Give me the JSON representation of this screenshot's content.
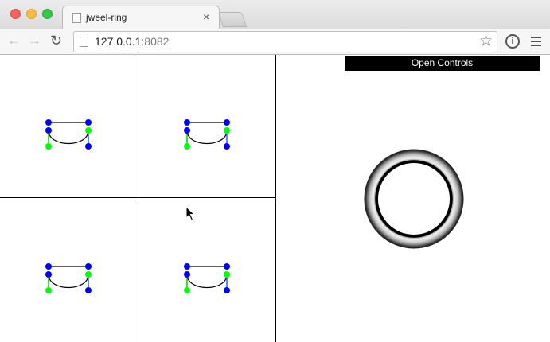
{
  "browser": {
    "tab_title": "jweel-ring",
    "tab_close_glyph": "×",
    "url_host": "127.0.0.1",
    "url_port": ":8082",
    "icons": {
      "back": "arrow-left-icon",
      "forward": "arrow-right-icon",
      "reload": "reload-icon",
      "bookmark": "star-icon",
      "info": "info-icon",
      "menu": "hamburger-menu-icon"
    }
  },
  "app": {
    "controls_label": "Open Controls",
    "viewport_count": 4,
    "colors": {
      "handle_primary": "#0000ff",
      "handle_secondary": "#00ff00",
      "curve": "#000000",
      "controls_bg": "#000000"
    }
  }
}
